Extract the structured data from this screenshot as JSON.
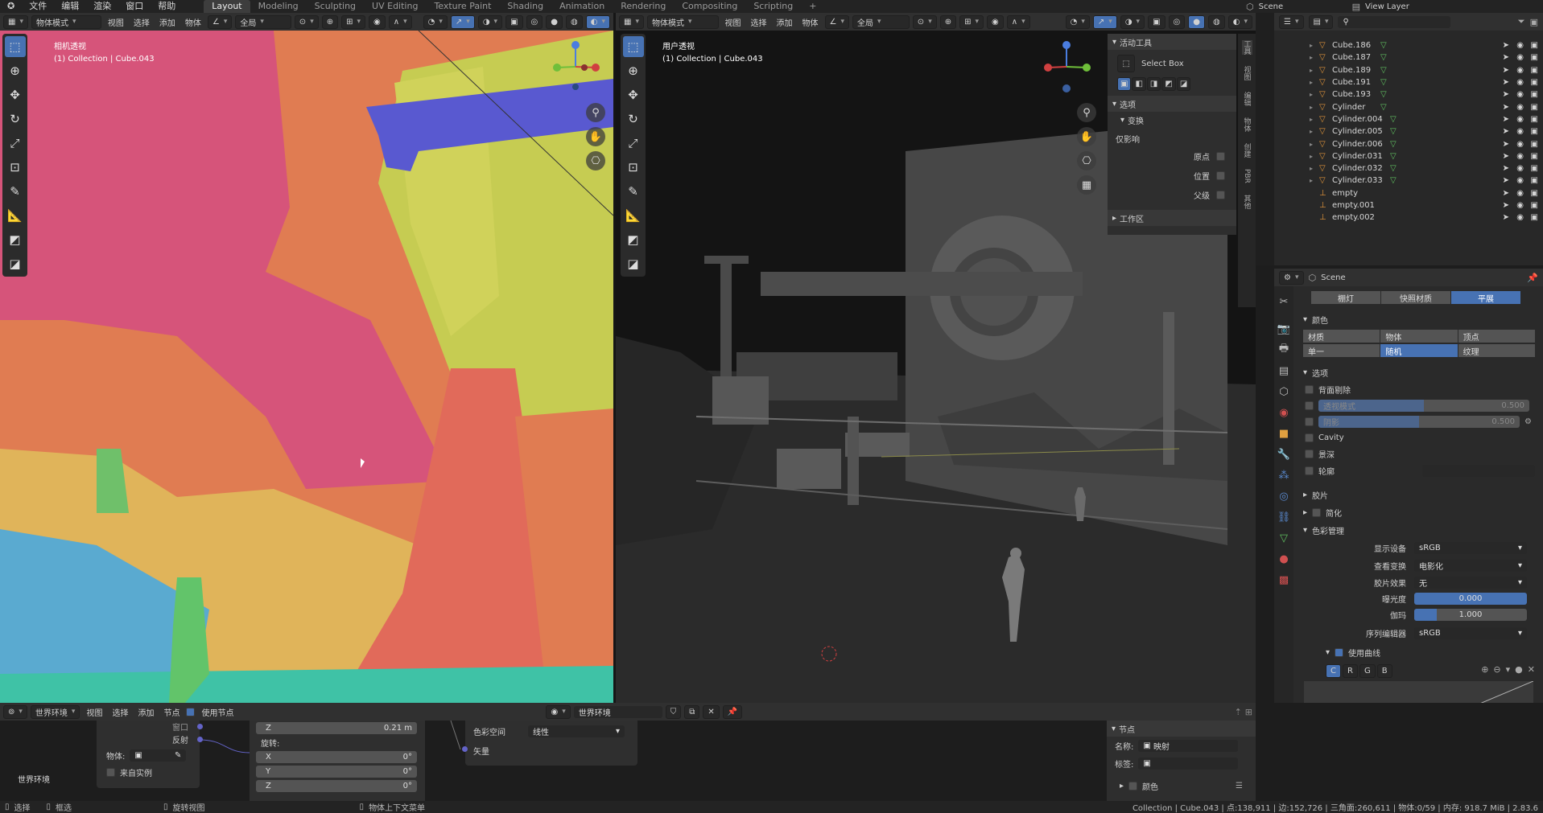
{
  "menu": {
    "logo": "✪",
    "items": [
      "文件",
      "编辑",
      "渲染",
      "窗口",
      "帮助"
    ]
  },
  "workspaces": [
    "Layout",
    "Modeling",
    "Sculpting",
    "UV Editing",
    "Texture Paint",
    "Shading",
    "Animation",
    "Rendering",
    "Compositing",
    "Scripting"
  ],
  "workspace_add": "+",
  "scene_name": "Scene",
  "view_layer": "View Layer",
  "left_viewport": {
    "mode": "物体模式",
    "menus": [
      "视图",
      "选择",
      "添加",
      "物体"
    ],
    "orient": "全局",
    "title": "相机透视",
    "subtitle": "(1) Collection | Cube.043"
  },
  "right_viewport": {
    "mode": "物体模式",
    "menus": [
      "视图",
      "选择",
      "添加",
      "物体"
    ],
    "orient": "全局",
    "title": "用户透视",
    "subtitle": "(1) Collection | Cube.043"
  },
  "npanel": {
    "active_tool_header": "活动工具",
    "select_box": "Select Box",
    "options_header": "选项",
    "transform_header": "变换",
    "affect_only": "仅影响",
    "origin": "原点",
    "location": "位置",
    "parent": "父级",
    "workspace_header": "工作区",
    "tabs": [
      "工具",
      "视图",
      "编辑",
      "物体",
      "创建",
      "PBR",
      "其他"
    ]
  },
  "outliner": {
    "rows": [
      {
        "name": "Cube.186",
        "icon": "mesh"
      },
      {
        "name": "Cube.187",
        "icon": "mesh"
      },
      {
        "name": "Cube.189",
        "icon": "mesh"
      },
      {
        "name": "Cube.191",
        "icon": "mesh"
      },
      {
        "name": "Cube.193",
        "icon": "mesh"
      },
      {
        "name": "Cylinder",
        "icon": "mesh"
      },
      {
        "name": "Cylinder.004",
        "icon": "mesh"
      },
      {
        "name": "Cylinder.005",
        "icon": "mesh"
      },
      {
        "name": "Cylinder.006",
        "icon": "mesh"
      },
      {
        "name": "Cylinder.031",
        "icon": "mesh"
      },
      {
        "name": "Cylinder.032",
        "icon": "mesh"
      },
      {
        "name": "Cylinder.033",
        "icon": "mesh"
      },
      {
        "name": "empty",
        "icon": "empty"
      },
      {
        "name": "empty.001",
        "icon": "empty"
      },
      {
        "name": "empty.002",
        "icon": "empty"
      }
    ]
  },
  "properties": {
    "scene": "Scene",
    "lighting_tabs": [
      "棚灯",
      "快照材质",
      "平展"
    ],
    "color_header": "颜色",
    "color_row1": [
      "材质",
      "物体",
      "顶点"
    ],
    "color_row2": [
      "单一",
      "随机",
      "纹理"
    ],
    "options_header": "选项",
    "backface": "背面剔除",
    "xray": "透视模式",
    "xray_value": "0.500",
    "xray_fill": 0.5,
    "shadow": "阴影",
    "shadow_value": "0.500",
    "shadow_fill": 0.5,
    "cavity": "Cavity",
    "depth": "景深",
    "outline": "轮廓",
    "film_header": "胶片",
    "simplify_header": "简化",
    "cm_header": "色彩管理",
    "display_device_label": "显示设备",
    "display_device": "sRGB",
    "view_transform_label": "查看变换",
    "view_transform": "电影化",
    "look_label": "胶片效果",
    "look": "无",
    "exposure_label": "曝光度",
    "exposure": "0.000",
    "gamma_label": "伽玛",
    "gamma": "1.000",
    "sequencer_label": "序列编辑器",
    "sequencer": "sRGB",
    "use_curves": "使用曲线",
    "curve_tabs": [
      "C",
      "R",
      "G",
      "B"
    ]
  },
  "node_editor": {
    "menus": [
      "视图",
      "选择",
      "添加",
      "节点"
    ],
    "world_label": "世界环境",
    "use_nodes": "使用节点",
    "world_name": "世界环境",
    "node_world_label": "世界环境",
    "node1_rows": [
      "窗口",
      "反射"
    ],
    "object_label": "物体:",
    "from_instancer": "来自实例",
    "z_label": "Z",
    "z_value": "0.21 m",
    "rotation_label": "旋转:",
    "rot": [
      {
        "axis": "X",
        "val": "0°"
      },
      {
        "axis": "Y",
        "val": "0°"
      },
      {
        "axis": "Z",
        "val": "0°"
      }
    ],
    "colorspace_label": "色彩空间",
    "colorspace": "线性",
    "vector_label": "矢量",
    "side_header": "节点",
    "name_label": "名称:",
    "name_value": "映射",
    "label_label": "标签:",
    "color_sub": "颜色"
  },
  "status": {
    "select": "选择",
    "box_select": "框选",
    "rotate_view": "旋转视图",
    "context_menu": "物体上下文菜单",
    "info": "Collection | Cube.043 | 点:138,911 | 边:152,726 | 三角面:260,611 | 物体:0/59 | 内存: 918.7 MiB | 2.83.6"
  },
  "colors": {
    "accent": "#4772b3",
    "bg": "#1d1d1d",
    "header": "#303030"
  }
}
